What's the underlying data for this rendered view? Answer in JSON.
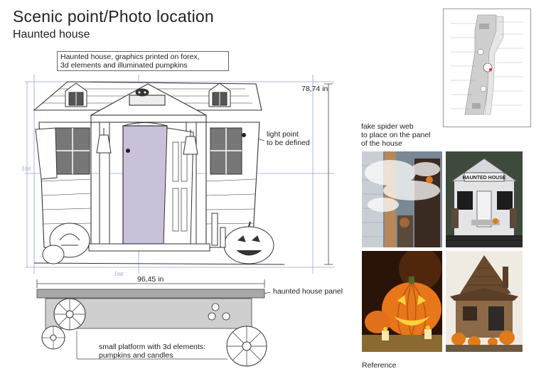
{
  "header": {
    "title": "Scenic point/Photo location",
    "subtitle": "Haunted house"
  },
  "drawing": {
    "note": "Haunted house, graphics printed on forex, 3d elements and illuminated pumpkins",
    "note_line1": "Haunted house, graphics printed on forex,",
    "note_line2": "3d elements and illuminated pumpkins",
    "height_dim": "78,74 in",
    "width_dim": "96,45 in",
    "light_point_line1": "light point",
    "light_point_line2": "to be defined",
    "panel_label": "haunted house panel",
    "platform_line1": "small platform with 3d elements:",
    "platform_line2": "pumpkins and candles",
    "scale_mark_vertical": "1mt",
    "scale_mark_horizontal": "1mt",
    "door_sign": ""
  },
  "reference": {
    "spider_line1": "fake spider web",
    "spider_line2": "to place on the panel",
    "spider_line3": "of the house",
    "photo_sign": "HAUNTED HOUSE",
    "caption": "Reference"
  },
  "colors": {
    "door": "#c9c0d9",
    "dimension": "#9aa0d8",
    "panel": "#a9a9a9",
    "platform": "#cfcfcf",
    "pumpkin": "#e07a1a"
  }
}
